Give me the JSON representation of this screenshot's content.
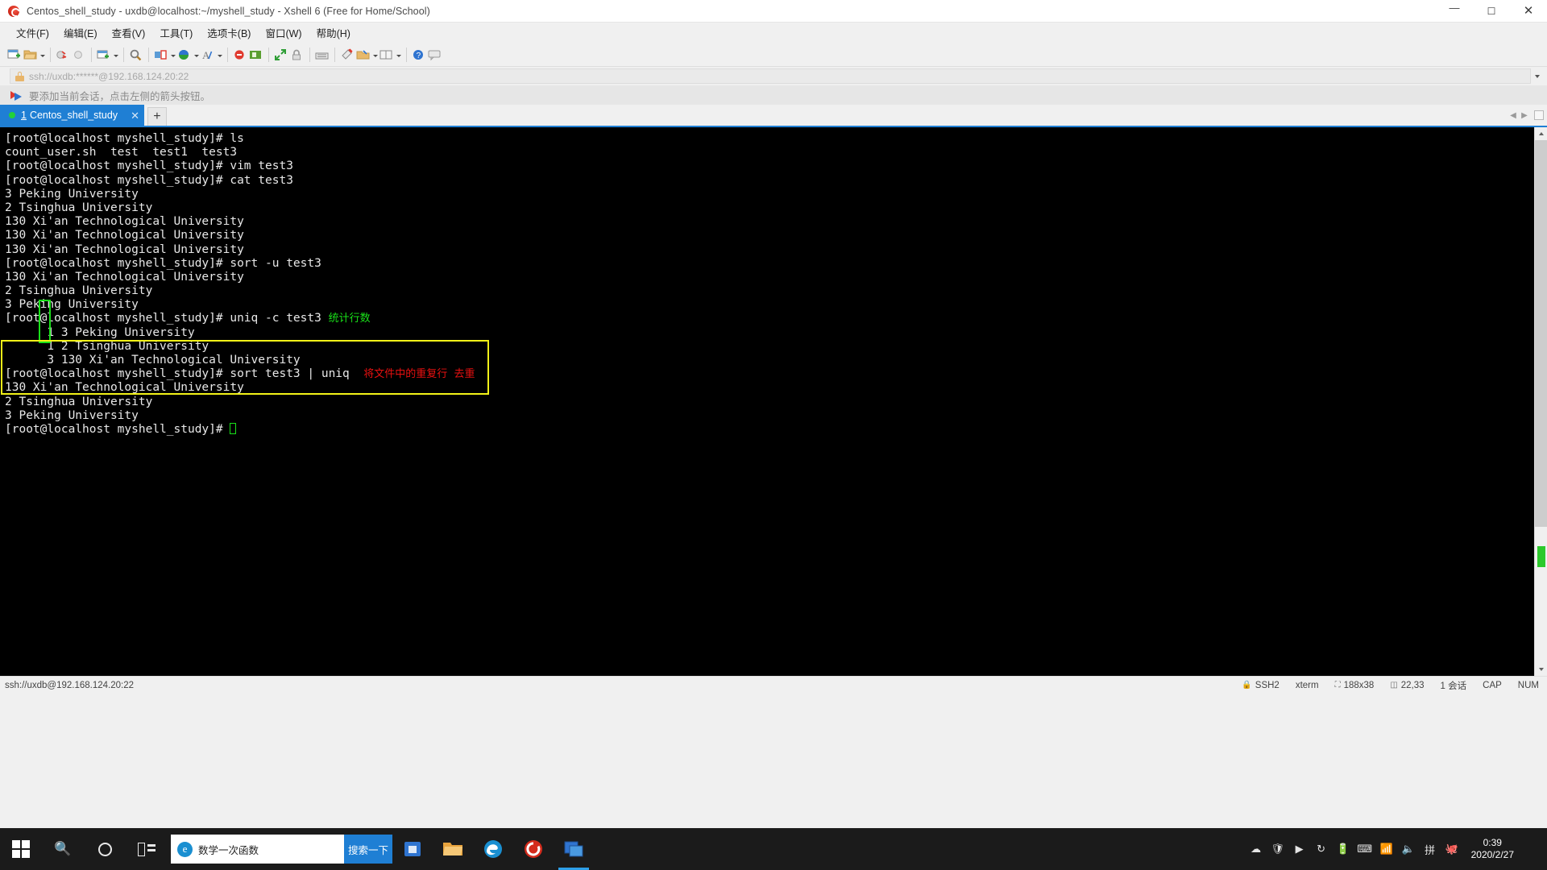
{
  "window": {
    "title": "Centos_shell_study - uxdb@localhost:~/myshell_study - Xshell 6 (Free for Home/School)",
    "app_icon": "xshell-icon",
    "controls": {
      "minimize": "─",
      "maximize": "☐",
      "close": "✕"
    }
  },
  "menubar": {
    "items": [
      {
        "label": "文件(F)",
        "name": "menu-file"
      },
      {
        "label": "编辑(E)",
        "name": "menu-edit"
      },
      {
        "label": "查看(V)",
        "name": "menu-view"
      },
      {
        "label": "工具(T)",
        "name": "menu-tools"
      },
      {
        "label": "选项卡(B)",
        "name": "menu-tabs"
      },
      {
        "label": "窗口(W)",
        "name": "menu-window"
      },
      {
        "label": "帮助(H)",
        "name": "menu-help"
      }
    ]
  },
  "toolbar": {
    "icons": [
      "new-session-icon",
      "open-folder-icon",
      "disconnect-icon",
      "reconnect-icon",
      "new-tab-icon",
      "find-icon",
      "transfer-icon",
      "globe-icon",
      "font-icon",
      "stop-icon",
      "log-icon",
      "fullscreen-icon",
      "lock-icon",
      "keyboard-icon",
      "highlight-icon",
      "folder-compose-icon",
      "layout-icon",
      "help-icon",
      "comment-icon"
    ]
  },
  "address_bar": {
    "icon": "lock-icon",
    "value": "ssh://uxdb:******@192.168.124.20:22",
    "dropdown_icon": "chevron-down-icon"
  },
  "notify_bar": {
    "icon": "arrow-flag-icon",
    "text": "要添加当前会话，点击左侧的箭头按钮。"
  },
  "tabs": {
    "active": {
      "status_dot": "connected-dot",
      "number": "1",
      "label": "Centos_shell_study",
      "close_icon": "close-icon"
    },
    "add_label": "+",
    "scroll_left": "◀",
    "scroll_right": "▶"
  },
  "terminal": {
    "prompt": "[root@localhost myshell_study]#",
    "lines": [
      {
        "text": "[root@localhost myshell_study]# ls",
        "color": "white"
      },
      {
        "text": "count_user.sh  test  test1  test3",
        "color": "white"
      },
      {
        "text": "[root@localhost myshell_study]# vim test3",
        "color": "white"
      },
      {
        "text": "[root@localhost myshell_study]# cat test3",
        "color": "white"
      },
      {
        "text": "3 Peking University",
        "color": "white"
      },
      {
        "text": "2 Tsinghua University",
        "color": "white"
      },
      {
        "text": "130 Xi'an Technological University",
        "color": "white"
      },
      {
        "text": "130 Xi'an Technological University",
        "color": "white"
      },
      {
        "text": "130 Xi'an Technological University",
        "color": "white"
      },
      {
        "text": "[root@localhost myshell_study]# sort -u test3",
        "color": "white"
      },
      {
        "text": "130 Xi'an Technological University",
        "color": "white"
      },
      {
        "text": "2 Tsinghua University",
        "color": "white"
      },
      {
        "text": "3 Peking University",
        "color": "white"
      },
      {
        "text": "[root@localhost myshell_study]# uniq -c test3 ",
        "color": "white",
        "annotation": "统计行数",
        "annotation_color": "green"
      },
      {
        "text": "      1 3 Peking University",
        "color": "white"
      },
      {
        "text": "      1 2 Tsinghua University",
        "color": "white"
      },
      {
        "text": "      3 130 Xi'an Technological University",
        "color": "white"
      },
      {
        "text": "[root@localhost myshell_study]# sort test3 | uniq  ",
        "color": "white",
        "annotation": "将文件中的重复行  去重",
        "annotation_color": "red"
      },
      {
        "text": "130 Xi'an Technological University",
        "color": "white"
      },
      {
        "text": "2 Tsinghua University",
        "color": "white"
      },
      {
        "text": "3 Peking University",
        "color": "white"
      },
      {
        "text": "[root@localhost myshell_study]# ",
        "color": "white",
        "cursor": true
      }
    ],
    "annotations": {
      "green_box": "count-column-highlight",
      "yellow_box": "sort-uniq-command-highlight"
    },
    "colors": {
      "background": "#000000",
      "foreground": "#e8e8e8",
      "green": "#19e019",
      "red": "#e81010",
      "yellow": "#f2f218"
    }
  },
  "statusbar": {
    "connection": "ssh://uxdb@192.168.124.20:22",
    "protocol": "SSH2",
    "terminal_type": "xterm",
    "size": "188x38",
    "cursor_position": "22,33",
    "sessions": "1 会话",
    "caps": "CAP",
    "num": "NUM"
  },
  "taskbar": {
    "start": "windows-logo-icon",
    "search_icon": "search-icon",
    "cortana_icon": "cortana-circle-icon",
    "taskview_icon": "task-view-icon",
    "search_box": {
      "icon": "edge-icon",
      "value": "数学一次函数",
      "button_label": "搜索一下"
    },
    "apps": [
      {
        "name": "taskbar-app-store",
        "icon": "store-icon"
      },
      {
        "name": "taskbar-app-explorer",
        "icon": "folder-icon"
      },
      {
        "name": "taskbar-app-edge",
        "icon": "edge-icon"
      },
      {
        "name": "taskbar-app-xshell",
        "icon": "xshell-icon"
      },
      {
        "name": "taskbar-app-xftp",
        "icon": "xftp-icon",
        "active": true
      }
    ],
    "tray": [
      "onedrive-icon",
      "shield-icon",
      "media-icon",
      "update-icon",
      "battery-icon",
      "keyboard-icon",
      "wifi-icon",
      "volume-icon",
      "ime-icon",
      "qq-icon"
    ],
    "clock": {
      "time": "0:39",
      "date": "2020/2/27"
    }
  }
}
